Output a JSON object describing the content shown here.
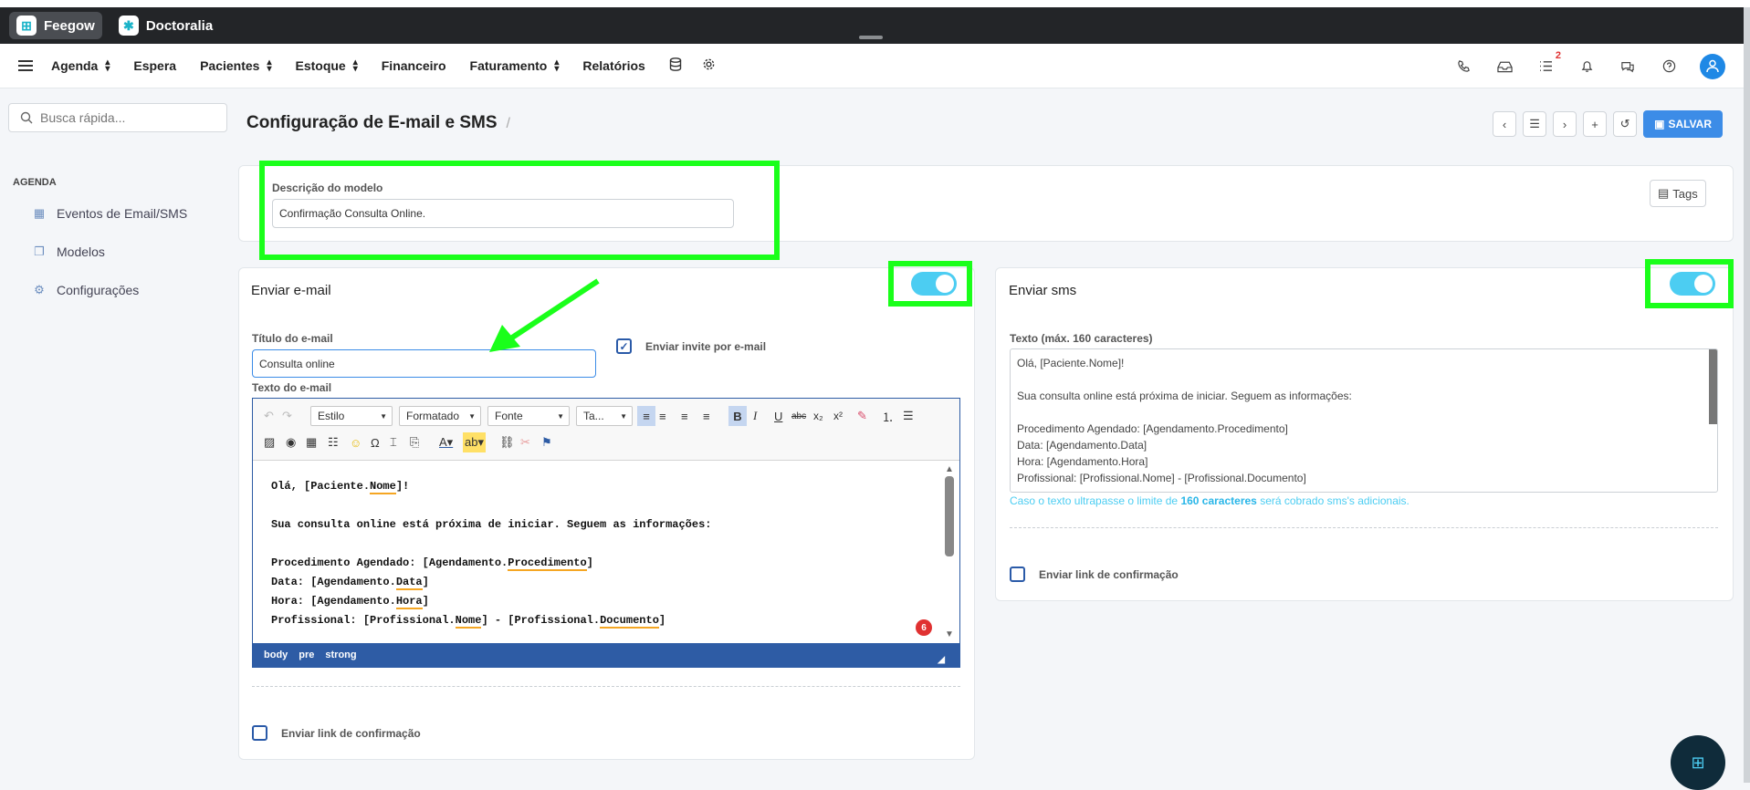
{
  "apps": [
    {
      "label": "Feegow",
      "active": true
    },
    {
      "label": "Doctoralia",
      "active": false
    }
  ],
  "nav": {
    "items": [
      {
        "label": "Agenda",
        "dropdown": true
      },
      {
        "label": "Espera",
        "dropdown": false
      },
      {
        "label": "Pacientes",
        "dropdown": true
      },
      {
        "label": "Estoque",
        "dropdown": true
      },
      {
        "label": "Financeiro",
        "dropdown": false
      },
      {
        "label": "Faturamento",
        "dropdown": true
      },
      {
        "label": "Relatórios",
        "dropdown": false
      }
    ],
    "tasks_badge": "2"
  },
  "sidebar": {
    "search_placeholder": "Busca rápida...",
    "section": "AGENDA",
    "items": [
      {
        "label": "Eventos de Email/SMS",
        "icon": "calendar-icon"
      },
      {
        "label": "Modelos",
        "icon": "copy-icon"
      },
      {
        "label": "Configurações",
        "icon": "gears-icon"
      }
    ]
  },
  "page": {
    "title": "Configuração de E-mail e SMS",
    "separator": "/"
  },
  "toolbar": {
    "save_label": "SALVAR"
  },
  "model": {
    "label": "Descrição do modelo",
    "value": "Confirmação Consulta Online.",
    "tags_label": "Tags"
  },
  "email": {
    "header": "Enviar e-mail",
    "enabled": true,
    "title_label": "Título do e-mail",
    "title_value": "Consulta online",
    "invite_label": "Enviar invite por e-mail",
    "invite_checked": true,
    "text_label": "Texto do e-mail",
    "confirm_label": "Enviar link de confirmação",
    "confirm_checked": false,
    "editor": {
      "style_combo": "Estilo",
      "format_combo": "Formatado",
      "font_combo": "Fonte",
      "size_combo": "Ta...",
      "error_count": "6",
      "path": [
        "body",
        "pre",
        "strong"
      ]
    }
  },
  "sms": {
    "header": "Enviar sms",
    "enabled": true,
    "text_label": "Texto (máx. 160 caracteres)",
    "lines": [
      "Olá, [Paciente.Nome]!",
      "",
      "Sua consulta online está próxima de iniciar. Seguem as informações:",
      "",
      "Procedimento Agendado: [Agendamento.Procedimento]",
      "Data: [Agendamento.Data]",
      "Hora: [Agendamento.Hora]",
      "Profissional: [Profissional.Nome] - [Profissional.Documento]"
    ],
    "note_prefix": "Caso o texto ultrapasse o limite de ",
    "note_bold": "160 caracteres",
    "note_suffix": " será cobrado sms's adicionais.",
    "confirm_label": "Enviar link de confirmação",
    "confirm_checked": false
  },
  "colors": {
    "highlight": "#1aff1a",
    "toggle": "#4ccdf2",
    "save": "#3c8ce7",
    "editor_border": "#2e5ca5"
  }
}
